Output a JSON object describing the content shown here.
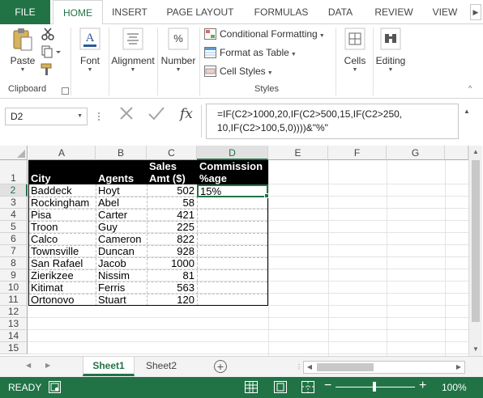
{
  "ribbon_tabs": {
    "file": "FILE",
    "items": [
      "HOME",
      "INSERT",
      "PAGE LAYOUT",
      "FORMULAS",
      "DATA",
      "REVIEW",
      "VIEW"
    ],
    "active": "HOME"
  },
  "ribbon": {
    "paste": "Paste",
    "clipboard": "Clipboard",
    "font": "Font",
    "alignment": "Alignment",
    "number": "Number",
    "conditional_formatting": "Conditional Formatting",
    "format_as_table": "Format as Table",
    "cell_styles": "Cell Styles",
    "styles": "Styles",
    "cells": "Cells",
    "editing": "Editing"
  },
  "formula_bar": {
    "name_box": "D2",
    "formula": "=IF(C2>1000,20,IF(C2>500,15,IF(C2>250,\n10,IF(C2>100,5,0))))&\"%\""
  },
  "columns": [
    "A",
    "B",
    "C",
    "D",
    "E",
    "F",
    "G"
  ],
  "rows": [
    "1",
    "2",
    "3",
    "4",
    "5",
    "6",
    "7",
    "8",
    "9",
    "10",
    "11",
    "12",
    "13",
    "14",
    "15"
  ],
  "headers": {
    "city": "City",
    "agents": "Agents",
    "sales_line1": "Sales",
    "sales_line2": "Amt ($)",
    "comm_line1": "Commission",
    "comm_line2": "%age"
  },
  "table": [
    {
      "city": "Baddeck",
      "agent": "Hoyt",
      "sales": "502",
      "commission": "15%"
    },
    {
      "city": "Rockingham",
      "agent": "Abel",
      "sales": "58",
      "commission": ""
    },
    {
      "city": "Pisa",
      "agent": "Carter",
      "sales": "421",
      "commission": ""
    },
    {
      "city": "Troon",
      "agent": "Guy",
      "sales": "225",
      "commission": ""
    },
    {
      "city": "Calco",
      "agent": "Cameron",
      "sales": "822",
      "commission": ""
    },
    {
      "city": "Townsville",
      "agent": "Duncan",
      "sales": "928",
      "commission": ""
    },
    {
      "city": "San Rafael",
      "agent": "Jacob",
      "sales": "1000",
      "commission": ""
    },
    {
      "city": "Zierikzee",
      "agent": "Nissim",
      "sales": "81",
      "commission": ""
    },
    {
      "city": "Kitimat",
      "agent": "Ferris",
      "sales": "563",
      "commission": ""
    },
    {
      "city": "Ortonovo",
      "agent": "Stuart",
      "sales": "120",
      "commission": ""
    }
  ],
  "sheet_tabs": [
    "Sheet1",
    "Sheet2"
  ],
  "active_sheet": "Sheet1",
  "status": {
    "text": "READY",
    "zoom": "100%"
  },
  "colors": {
    "accent": "#217346",
    "header_fill": "#000000",
    "header_text": "#ffffff"
  }
}
